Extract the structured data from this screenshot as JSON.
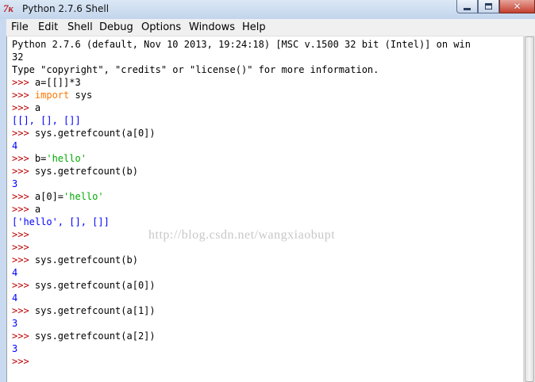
{
  "window": {
    "title": "Python 2.7.6 Shell",
    "icon_glyph": "7ĸ",
    "close_glyph": "✕"
  },
  "menu": [
    "File",
    "Edit",
    "Shell",
    "Debug",
    "Options",
    "Windows",
    "Help"
  ],
  "shell": {
    "lines": [
      [
        {
          "t": "Python 2.7.6 (default, Nov 10 2013, 19:24:18) [MSC v.1500 32 bit (Intel)] on win",
          "c": ""
        }
      ],
      [
        {
          "t": "32",
          "c": ""
        }
      ],
      [
        {
          "t": "Type \"copyright\", \"credits\" or \"license()\" for more information.",
          "c": ""
        }
      ],
      [
        {
          "t": ">>> ",
          "c": "prompt"
        },
        {
          "t": "a=[[]]*3",
          "c": ""
        }
      ],
      [
        {
          "t": ">>> ",
          "c": "prompt"
        },
        {
          "t": "import",
          "c": "kw"
        },
        {
          "t": " sys",
          "c": ""
        }
      ],
      [
        {
          "t": ">>> ",
          "c": "prompt"
        },
        {
          "t": "a",
          "c": ""
        }
      ],
      [
        {
          "t": "[[], [], []]",
          "c": "out"
        }
      ],
      [
        {
          "t": ">>> ",
          "c": "prompt"
        },
        {
          "t": "sys.getrefcount(a[0])",
          "c": ""
        }
      ],
      [
        {
          "t": "4",
          "c": "out"
        }
      ],
      [
        {
          "t": ">>> ",
          "c": "prompt"
        },
        {
          "t": "b=",
          "c": ""
        },
        {
          "t": "'hello'",
          "c": "str"
        }
      ],
      [
        {
          "t": ">>> ",
          "c": "prompt"
        },
        {
          "t": "sys.getrefcount(b)",
          "c": ""
        }
      ],
      [
        {
          "t": "3",
          "c": "out"
        }
      ],
      [
        {
          "t": ">>> ",
          "c": "prompt"
        },
        {
          "t": "a[0]=",
          "c": ""
        },
        {
          "t": "'hello'",
          "c": "str"
        }
      ],
      [
        {
          "t": ">>> ",
          "c": "prompt"
        },
        {
          "t": "a",
          "c": ""
        }
      ],
      [
        {
          "t": "['hello', [], []]",
          "c": "out"
        }
      ],
      [
        {
          "t": ">>>",
          "c": "prompt"
        }
      ],
      [
        {
          "t": ">>>",
          "c": "prompt"
        }
      ],
      [
        {
          "t": ">>> ",
          "c": "prompt"
        },
        {
          "t": "sys.getrefcount(b)",
          "c": ""
        }
      ],
      [
        {
          "t": "4",
          "c": "out"
        }
      ],
      [
        {
          "t": ">>> ",
          "c": "prompt"
        },
        {
          "t": "sys.getrefcount(a[0])",
          "c": ""
        }
      ],
      [
        {
          "t": "4",
          "c": "out"
        }
      ],
      [
        {
          "t": ">>> ",
          "c": "prompt"
        },
        {
          "t": "sys.getrefcount(a[1])",
          "c": ""
        }
      ],
      [
        {
          "t": "3",
          "c": "out"
        }
      ],
      [
        {
          "t": ">>> ",
          "c": "prompt"
        },
        {
          "t": "sys.getrefcount(a[2])",
          "c": ""
        }
      ],
      [
        {
          "t": "3",
          "c": "out"
        }
      ],
      [
        {
          "t": ">>> ",
          "c": "prompt"
        }
      ]
    ]
  },
  "watermark": "http://blog.csdn.net/wangxiaobupt",
  "colors": {
    "prompt": "#c00000",
    "keyword": "#ff7700",
    "string": "#00aa00",
    "output": "#0000ff"
  }
}
